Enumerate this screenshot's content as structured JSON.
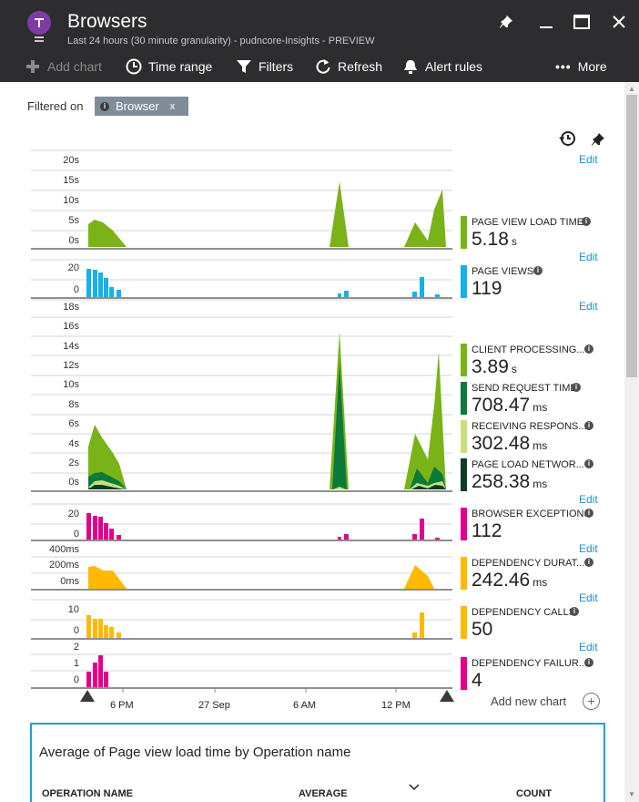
{
  "header": {
    "title": "Browsers",
    "subtitle": "Last 24 hours (30 minute granularity) - pudncore-Insights - PREVIEW"
  },
  "toolbar": {
    "add_chart": "Add chart",
    "time_range": "Time range",
    "filters": "Filters",
    "refresh": "Refresh",
    "alert_rules": "Alert rules",
    "more": "More"
  },
  "filter": {
    "label": "Filtered on",
    "chip": "Browser",
    "chip_close": "x"
  },
  "edit_label": "Edit",
  "metrics": [
    {
      "name": "PAGE VIEW LOAD TIME",
      "value": "5.18",
      "unit": "s",
      "color": "#7ab317"
    },
    {
      "name": "PAGE VIEWS",
      "value": "119",
      "unit": "",
      "color": "#14b1ea"
    },
    {
      "name": "CLIENT PROCESSING...",
      "value": "3.89",
      "unit": "s",
      "color": "#7ab317"
    },
    {
      "name": "SEND REQUEST TIME",
      "value": "708.47",
      "unit": "ms",
      "color": "#0b7a3b"
    },
    {
      "name": "RECEIVING RESPONS...",
      "value": "302.48",
      "unit": "ms",
      "color": "#c6e17a"
    },
    {
      "name": "PAGE LOAD NETWOR...",
      "value": "258.38",
      "unit": "ms",
      "color": "#0e3d24"
    },
    {
      "name": "BROWSER EXCEPTIONS",
      "value": "112",
      "unit": "",
      "color": "#e3008c"
    },
    {
      "name": "DEPENDENCY DURAT...",
      "value": "242.46",
      "unit": "ms",
      "color": "#ffb900"
    },
    {
      "name": "DEPENDENCY CALLS",
      "value": "50",
      "unit": "",
      "color": "#ffb900"
    },
    {
      "name": "DEPENDENCY FAILUR...",
      "value": "4",
      "unit": "",
      "color": "#e3008c"
    }
  ],
  "axes": {
    "c1": [
      "20s",
      "15s",
      "10s",
      "5s",
      "0s"
    ],
    "c2": [
      "20",
      "0"
    ],
    "c3": [
      "18s",
      "16s",
      "14s",
      "12s",
      "10s",
      "8s",
      "6s",
      "4s",
      "2s",
      "0s"
    ],
    "c4": [
      "20",
      "0"
    ],
    "c5": [
      "400ms",
      "200ms",
      "0ms"
    ],
    "c6": [
      "10",
      "0"
    ],
    "c7": [
      "2",
      "1",
      "0"
    ],
    "x": [
      "6 PM",
      "27 Sep",
      "6 AM",
      "12 PM"
    ]
  },
  "add_new_chart": "Add new chart",
  "table": {
    "title": "Average of Page view load time by Operation name",
    "columns": [
      "OPERATION NAME",
      "AVERAGE",
      "COUNT"
    ]
  },
  "chart_data": {
    "type": "area",
    "series": [
      {
        "name": "PAGE VIEW LOAD TIME",
        "peak_values_s": [
          5,
          16,
          6,
          13
        ]
      },
      {
        "name": "PAGE VIEWS",
        "peak_values": [
          20,
          2,
          15
        ]
      },
      {
        "name": "BROWSER EXCEPTIONS",
        "peak_values": [
          20,
          3,
          15
        ]
      },
      {
        "name": "DEPENDENCY CALLS",
        "peak_values": [
          10,
          12
        ]
      },
      {
        "name": "DEPENDENCY FAILUR...",
        "peak_values": [
          2
        ]
      }
    ]
  }
}
